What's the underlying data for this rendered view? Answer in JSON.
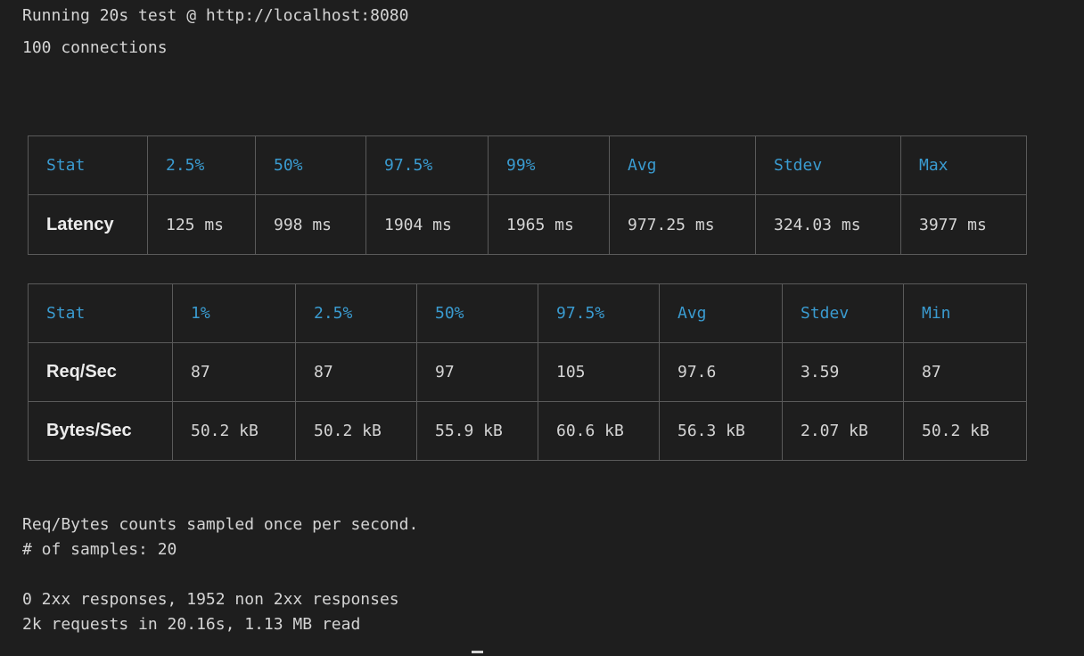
{
  "header": {
    "line1": "Running 20s test @ http://localhost:8080",
    "line2": "100 connections"
  },
  "latency_table": {
    "headers": [
      "Stat",
      "2.5%",
      "50%",
      "97.5%",
      "99%",
      "Avg",
      "Stdev",
      "Max"
    ],
    "rows": [
      [
        "Latency",
        "125 ms",
        "998 ms",
        "1904 ms",
        "1965 ms",
        "977.25 ms",
        "324.03 ms",
        "3977 ms"
      ]
    ]
  },
  "throughput_table": {
    "headers": [
      "Stat",
      "1%",
      "2.5%",
      "50%",
      "97.5%",
      "Avg",
      "Stdev",
      "Min"
    ],
    "rows": [
      [
        "Req/Sec",
        "87",
        "87",
        "97",
        "105",
        "97.6",
        "3.59",
        "87"
      ],
      [
        "Bytes/Sec",
        "50.2 kB",
        "50.2 kB",
        "55.9 kB",
        "60.6 kB",
        "56.3 kB",
        "2.07 kB",
        "50.2 kB"
      ]
    ]
  },
  "footer": {
    "line1": "Req/Bytes counts sampled once per second.",
    "line2": "# of samples: 20",
    "line3": "0 2xx responses, 1952 non 2xx responses",
    "line4": "2k requests in 20.16s, 1.13 MB read"
  },
  "colors": {
    "background": "#1e1e1e",
    "text": "#d4d4d4",
    "header_text": "#3a9bd0",
    "border": "#5a5a5a"
  }
}
